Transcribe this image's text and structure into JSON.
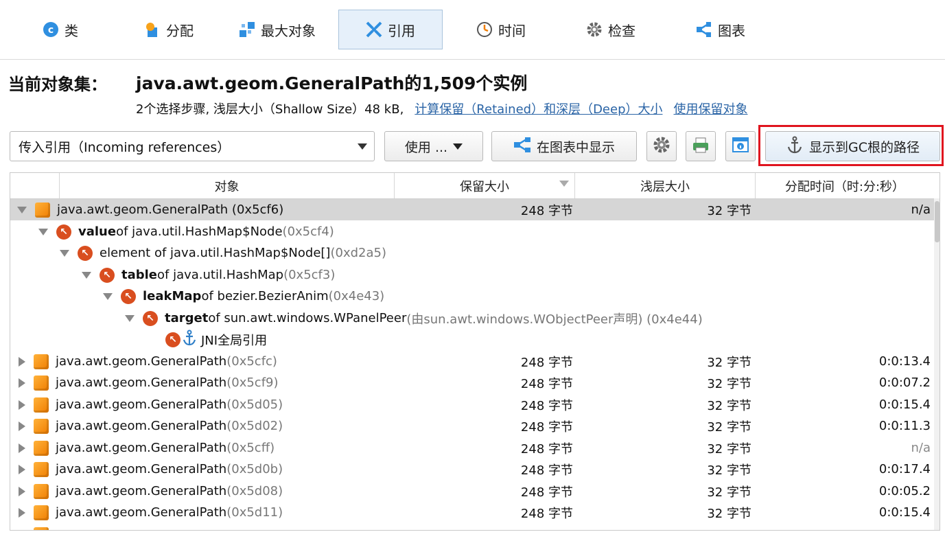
{
  "tabs": [
    {
      "label": "类",
      "icon": "class-icon"
    },
    {
      "label": "分配",
      "icon": "allocation-icon"
    },
    {
      "label": "最大对象",
      "icon": "biggest-objects-icon"
    },
    {
      "label": "引用",
      "icon": "references-icon"
    },
    {
      "label": "时间",
      "icon": "clock-icon"
    },
    {
      "label": "检查",
      "icon": "gear-icon"
    },
    {
      "label": "图表",
      "icon": "graph-icon"
    }
  ],
  "header": {
    "label": "当前对象集：",
    "value": "java.awt.geom.GeneralPath的1,509个实例",
    "info": "2个选择步骤, 浅层大小（Shallow Size）48 kB,",
    "link1": "计算保留（Retained）和深层（Deep）大小",
    "link2": "使用保留对象"
  },
  "toolbar": {
    "combo_value": "传入引用（Incoming references）",
    "use_label": "使用 ...",
    "graph_label": "在图表中显示",
    "gc_label": "显示到GC根的路径"
  },
  "columns": {
    "object": "对象",
    "retained": "保留大小",
    "shallow": "浅层大小",
    "alloc": "分配时间（时:分:秒）"
  },
  "rows": [
    {
      "name": "java.awt.geom.GeneralPath (0x5cf6)",
      "retained": "248 字节",
      "shallow": "32 字节",
      "time": "n/a"
    },
    {
      "bold": "value",
      "rest": " of java.util.HashMap$Node ",
      "addr": "(0x5cf4)"
    },
    {
      "bold": "",
      "rest": "element of java.util.HashMap$Node[] ",
      "addr": "(0xd2a5)"
    },
    {
      "bold": "table",
      "rest": " of java.util.HashMap ",
      "addr": "(0x5cf3)"
    },
    {
      "bold": "leakMap",
      "rest": " of bezier.BezierAnim ",
      "addr": "(0x4e43)"
    },
    {
      "bold": "target",
      "rest": " of sun.awt.windows.WPanelPeer ",
      "addr": "(由sun.awt.windows.WObjectPeer声明) (0x4e44)"
    },
    {
      "rest": "JNI全局引用"
    },
    {
      "name": "java.awt.geom.GeneralPath",
      "addr": " (0x5cfc)",
      "retained": "248 字节",
      "shallow": "32 字节",
      "time": "0:0:13.4"
    },
    {
      "name": "java.awt.geom.GeneralPath",
      "addr": " (0x5cf9)",
      "retained": "248 字节",
      "shallow": "32 字节",
      "time": "0:0:07.2"
    },
    {
      "name": "java.awt.geom.GeneralPath",
      "addr": " (0x5d05)",
      "retained": "248 字节",
      "shallow": "32 字节",
      "time": "0:0:15.4"
    },
    {
      "name": "java.awt.geom.GeneralPath",
      "addr": " (0x5d02)",
      "retained": "248 字节",
      "shallow": "32 字节",
      "time": "0:0:11.3"
    },
    {
      "name": "java.awt.geom.GeneralPath",
      "addr": " (0x5cff)",
      "retained": "248 字节",
      "shallow": "32 字节",
      "time": "n/a"
    },
    {
      "name": "java.awt.geom.GeneralPath",
      "addr": " (0x5d0b)",
      "retained": "248 字节",
      "shallow": "32 字节",
      "time": "0:0:17.4"
    },
    {
      "name": "java.awt.geom.GeneralPath",
      "addr": " (0x5d08)",
      "retained": "248 字节",
      "shallow": "32 字节",
      "time": "0:0:05.2"
    },
    {
      "name": "java.awt.geom.GeneralPath",
      "addr": " (0x5d11)",
      "retained": "248 字节",
      "shallow": "32 字节",
      "time": "0:0:15.4"
    }
  ]
}
